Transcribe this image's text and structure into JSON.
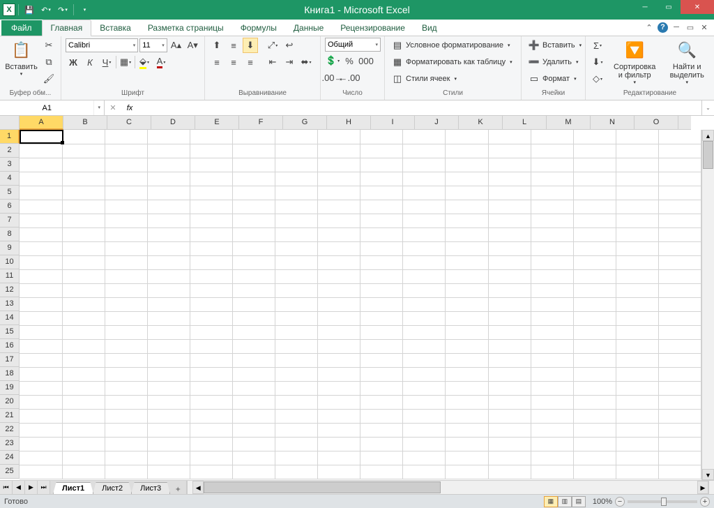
{
  "title": "Книга1 - Microsoft Excel",
  "tabs": {
    "file": "Файл",
    "home": "Главная",
    "insert": "Вставка",
    "layout": "Разметка страницы",
    "formulas": "Формулы",
    "data": "Данные",
    "review": "Рецензирование",
    "view": "Вид"
  },
  "ribbon": {
    "clipboard": {
      "paste": "Вставить",
      "label": "Буфер обм..."
    },
    "font": {
      "name": "Calibri",
      "size": "11",
      "label": "Шрифт",
      "bold": "Ж",
      "italic": "К",
      "underline": "Ч"
    },
    "align": {
      "label": "Выравнивание"
    },
    "number": {
      "format": "Общий",
      "label": "Число"
    },
    "styles": {
      "cond": "Условное форматирование",
      "table": "Форматировать как таблицу",
      "cell": "Стили ячеек",
      "label": "Стили"
    },
    "cells": {
      "insert": "Вставить",
      "delete": "Удалить",
      "format": "Формат",
      "label": "Ячейки"
    },
    "editing": {
      "sort": "Сортировка и фильтр",
      "find": "Найти и выделить",
      "label": "Редактирование"
    }
  },
  "namebox": "A1",
  "columns": [
    "A",
    "B",
    "C",
    "D",
    "E",
    "F",
    "G",
    "H",
    "I",
    "J",
    "K",
    "L",
    "M",
    "N",
    "O"
  ],
  "rows": [
    "1",
    "2",
    "3",
    "4",
    "5",
    "6",
    "7",
    "8",
    "9",
    "10",
    "11",
    "12",
    "13",
    "14",
    "15",
    "16",
    "17",
    "18",
    "19",
    "20",
    "21",
    "22",
    "23",
    "24",
    "25"
  ],
  "sheets": {
    "s1": "Лист1",
    "s2": "Лист2",
    "s3": "Лист3"
  },
  "status": {
    "ready": "Готово",
    "zoom": "100%"
  }
}
